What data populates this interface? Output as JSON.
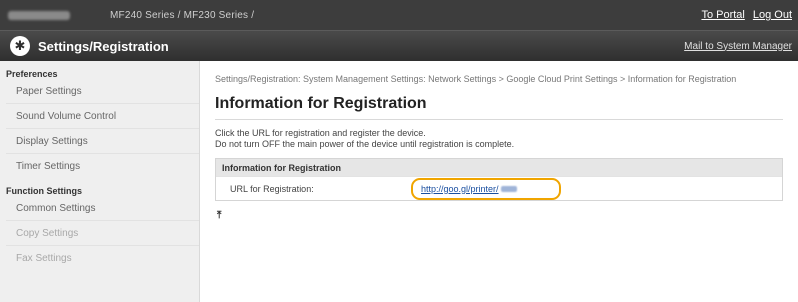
{
  "topbar": {
    "device_model": "MF240 Series / MF230 Series /",
    "to_portal": "To Portal",
    "log_out": "Log Out"
  },
  "titlebar": {
    "gear_icon": "gear-icon",
    "title": "Settings/Registration",
    "mail_link": "Mail to System Manager"
  },
  "sidebar": {
    "preferences": "Preferences",
    "items_pref": [
      "Paper Settings",
      "Sound Volume Control",
      "Display Settings",
      "Timer Settings"
    ],
    "function": "Function Settings",
    "items_func": [
      "Common Settings",
      "Copy Settings",
      "Fax Settings"
    ]
  },
  "main": {
    "breadcrumb": "Settings/Registration: System Management Settings: Network Settings > Google Cloud Print Settings > Information for Registration",
    "title": "Information for Registration",
    "desc_line1": "Click the URL for registration and register the device.",
    "desc_line2": "Do not turn OFF the main power of the device until registration is complete.",
    "table_head": "Information for Registration",
    "url_label": "URL for Registration:",
    "url_value": "http://goo.gl/printer/",
    "top_icon": "to-top-icon"
  },
  "colors": {
    "highlight": "#f0a500",
    "link": "#1a4fa0"
  }
}
